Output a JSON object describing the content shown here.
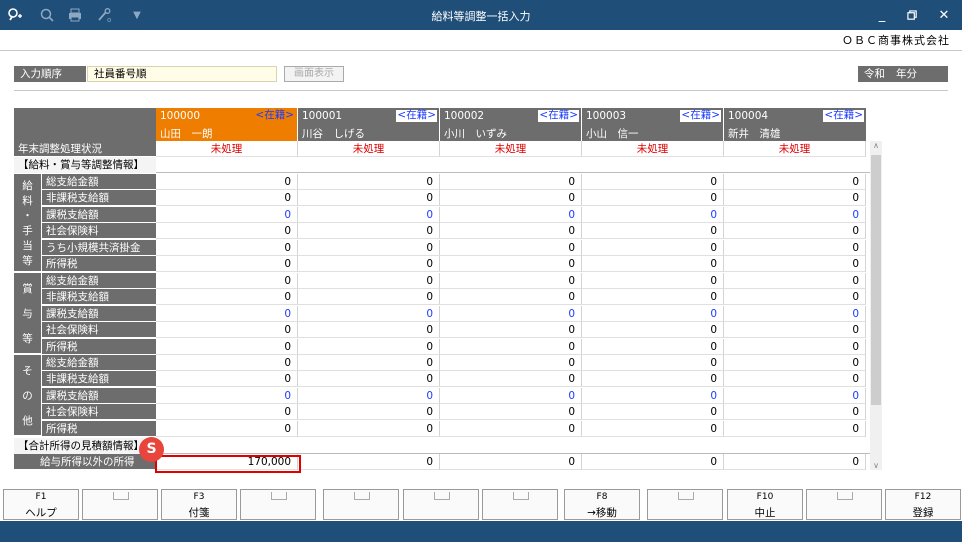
{
  "window": {
    "title": "給料等調整一括入力",
    "company": "ＯＢＣ商事株式会社"
  },
  "input_order": {
    "label": "入力順序",
    "value": "社員番号順",
    "screen_button": "画面表示"
  },
  "era": {
    "label": "令和",
    "value": "年分"
  },
  "employees": [
    {
      "code": "100000",
      "status": "<在籍>",
      "name": "山田　一朗"
    },
    {
      "code": "100001",
      "status": "<在籍>",
      "name": "川谷　しげる"
    },
    {
      "code": "100002",
      "status": "<在籍>",
      "name": "小川　いずみ"
    },
    {
      "code": "100003",
      "status": "<在籍>",
      "name": "小山　信一"
    },
    {
      "code": "100004",
      "status": "<在籍>",
      "name": "新井　清雄"
    }
  ],
  "rows": {
    "status_label": "年末調整処理状況",
    "status_value": "未処理",
    "section1": "【給料・賞与等調整情報】",
    "group1": [
      "給",
      "料",
      "・",
      "手",
      "当",
      "等"
    ],
    "group2": [
      "賞",
      "与",
      "等"
    ],
    "group3": [
      "そ",
      "の",
      "他"
    ],
    "labels": [
      "総支給金額",
      "非課税支給額",
      "課税支給額",
      "社会保険料",
      "うち小規模共済掛金",
      "所得税"
    ],
    "labels2": [
      "総支給金額",
      "非課税支給額",
      "課税支給額",
      "社会保険料",
      "所得税"
    ],
    "section2": "【合計所得の見積額情報】",
    "other_income_label": "給与所得以外の所得",
    "zero": "0",
    "other_income": [
      "170,000",
      "0",
      "0",
      "0",
      "0"
    ]
  },
  "badge": "S",
  "fkeys": [
    {
      "num": "F1",
      "label": "ヘルプ"
    },
    {
      "num": "",
      "label": ""
    },
    {
      "num": "F3",
      "label": "付箋"
    },
    {
      "num": "",
      "label": ""
    },
    {
      "num": "",
      "label": ""
    },
    {
      "num": "",
      "label": ""
    },
    {
      "num": "",
      "label": ""
    },
    {
      "num": "F8",
      "label": "→移動"
    },
    {
      "num": "",
      "label": ""
    },
    {
      "num": "F10",
      "label": "中止"
    },
    {
      "num": "",
      "label": ""
    },
    {
      "num": "F12",
      "label": "登録"
    }
  ],
  "colors": {
    "titlebar": "#1f4e79",
    "selected": "#ef7d00",
    "header_grey": "#6d6d6d",
    "alert_red": "#e00000",
    "blue_value": "#1c3cff"
  }
}
